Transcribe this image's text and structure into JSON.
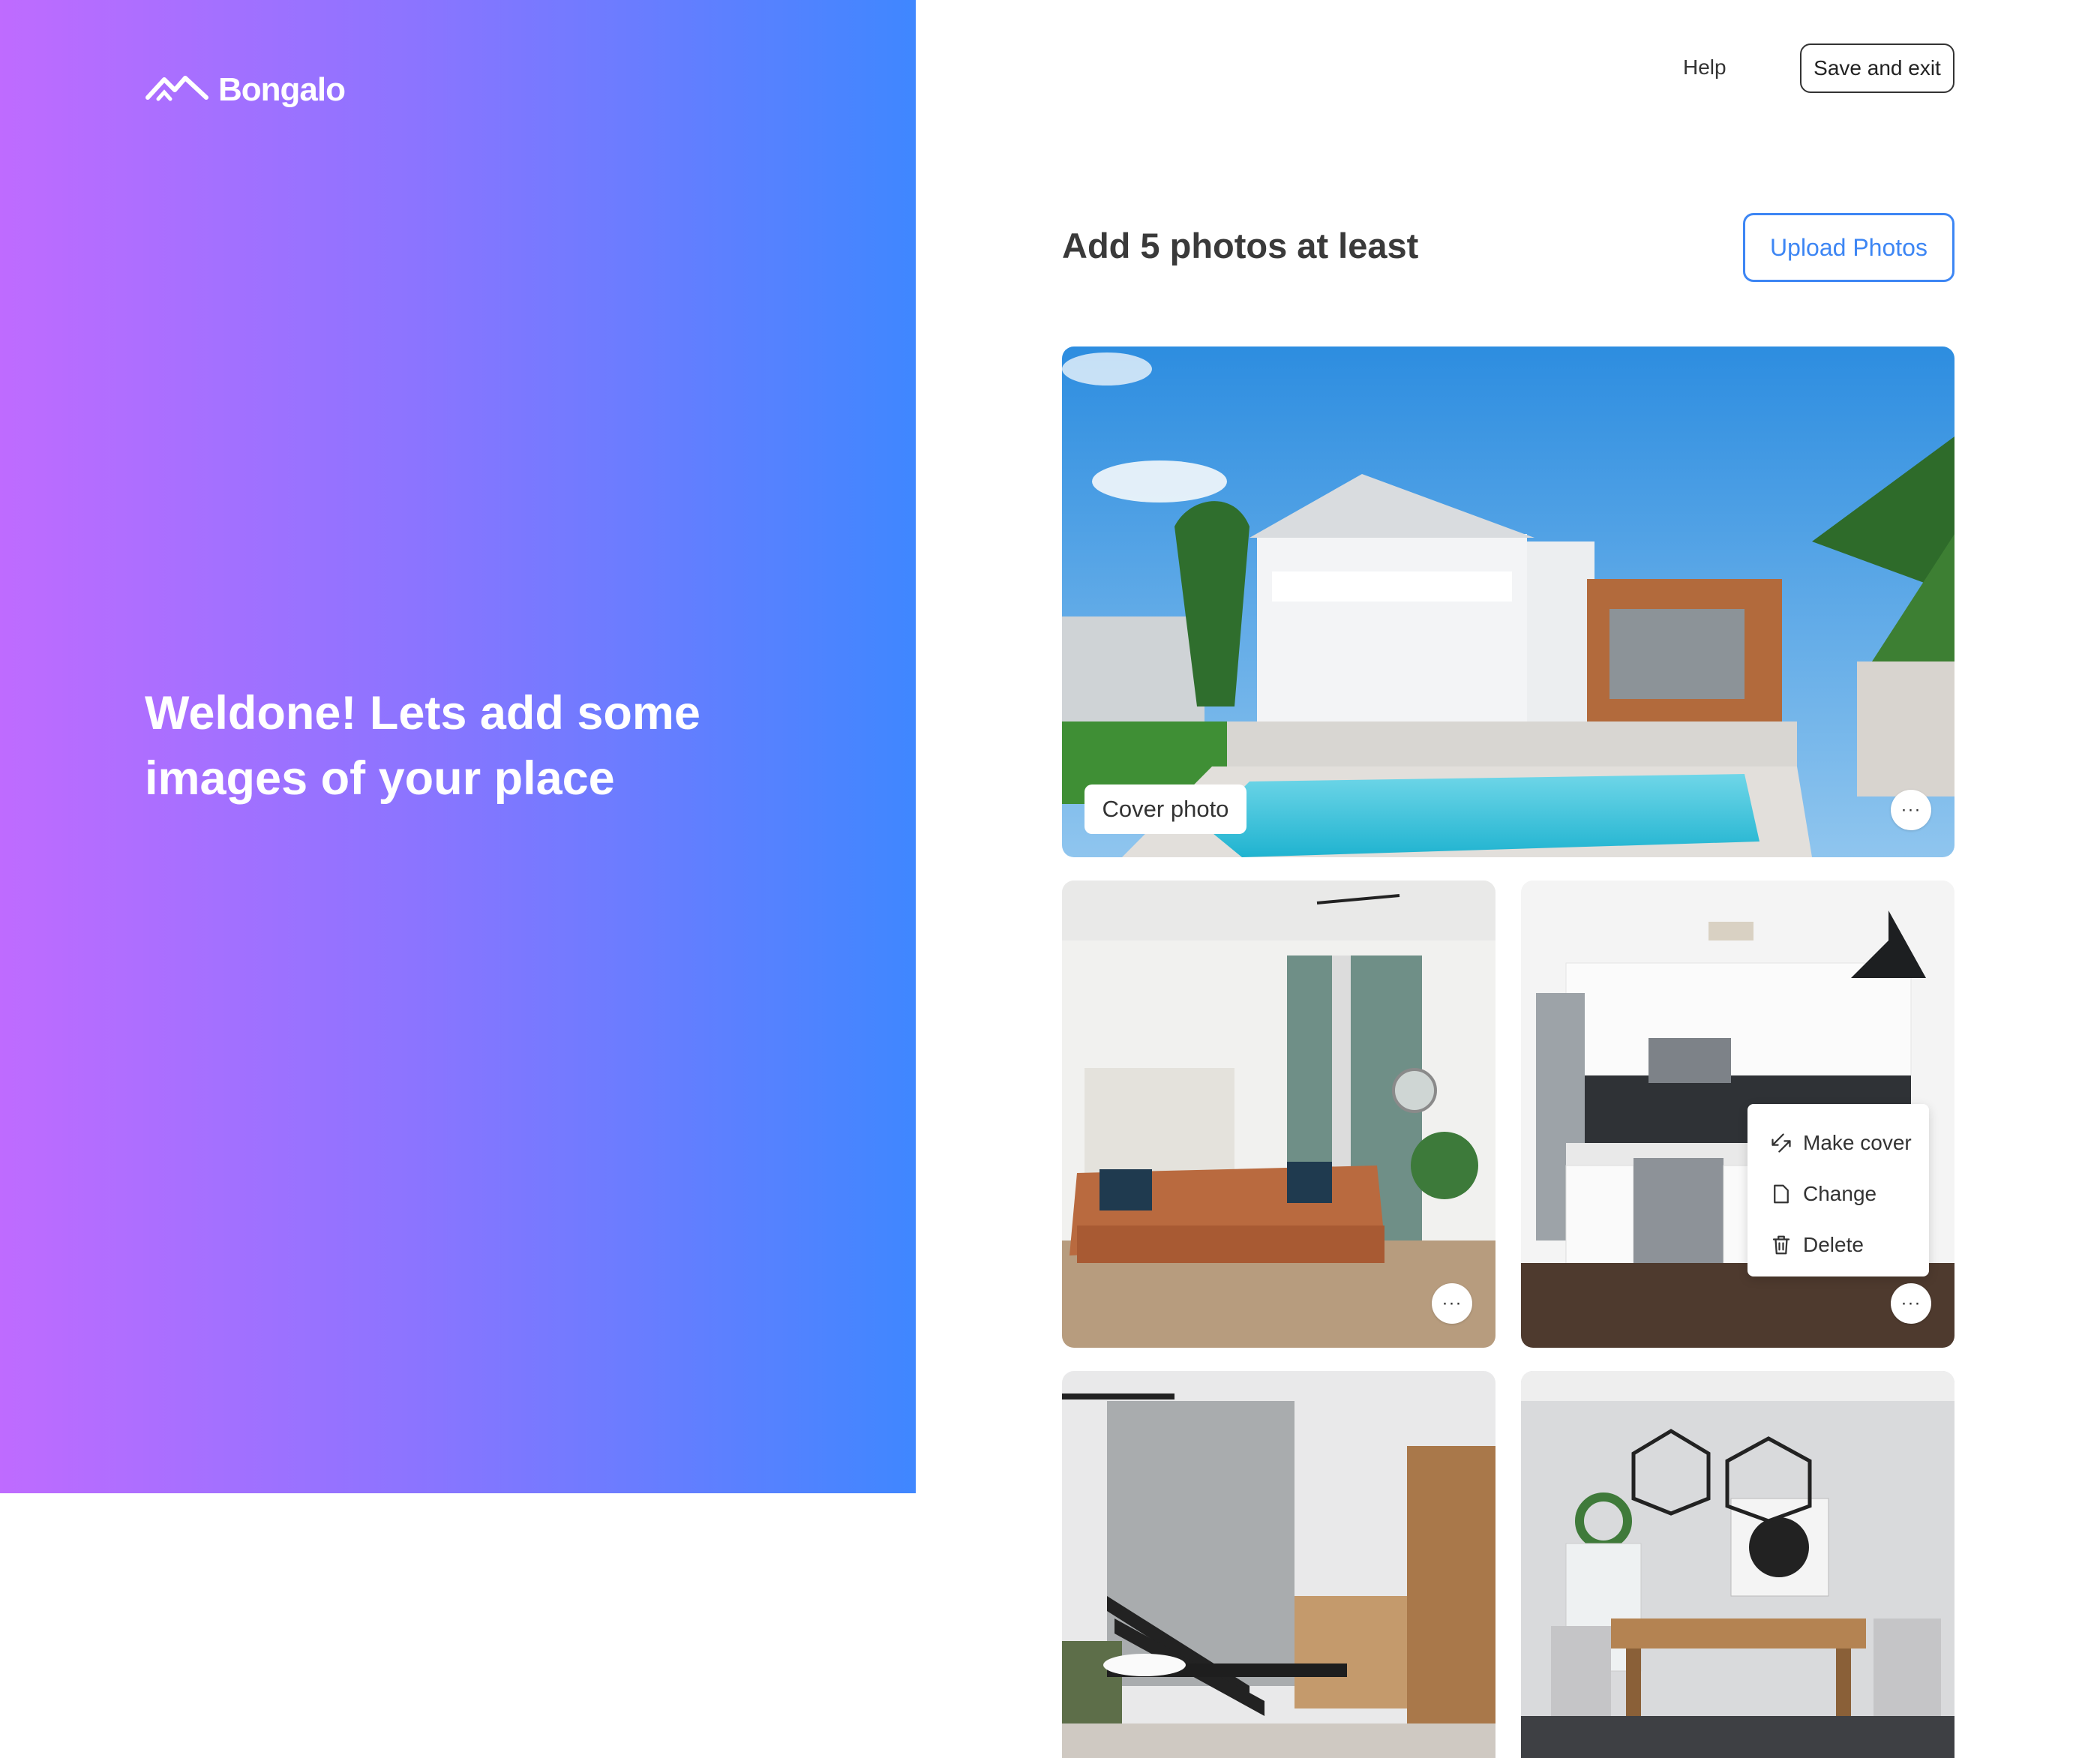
{
  "brand": {
    "name": "Bongalo"
  },
  "hero": {
    "headline": "Weldone! Lets add some images of your place"
  },
  "header": {
    "help_label": "Help",
    "save_exit_label": "Save and exit"
  },
  "main": {
    "title": "Add 5 photos at least",
    "upload_label": "Upload Photos",
    "cover_badge": "Cover photo",
    "more_icon_glyph": "···"
  },
  "context_menu": {
    "items": [
      {
        "label": "Make cover",
        "icon": "swap-arrows-icon"
      },
      {
        "label": "Change",
        "icon": "file-icon"
      },
      {
        "label": "Delete",
        "icon": "trash-icon"
      }
    ]
  },
  "colors": {
    "gradient_start": "#bf6bff",
    "gradient_end": "#3f87ff",
    "accent_blue": "#3d86f4"
  }
}
